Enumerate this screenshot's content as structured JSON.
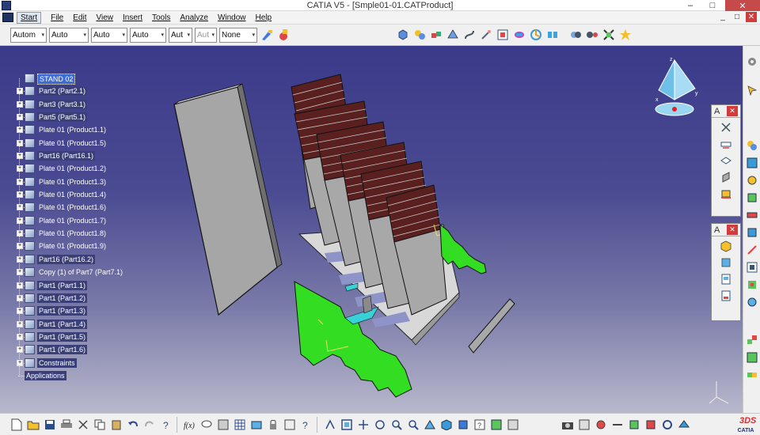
{
  "window": {
    "title": "CATIA V5 - [Smple01-01.CATProduct]",
    "min": "–",
    "max": "□",
    "close": "✕"
  },
  "menubar": {
    "items": [
      "Start",
      "File",
      "Edit",
      "View",
      "Insert",
      "Tools",
      "Analyze",
      "Window",
      "Help"
    ],
    "mdi_min": "_",
    "mdi_max": "□",
    "mdi_close": "✕"
  },
  "toolbar": {
    "dropdowns": [
      {
        "value": "Autom",
        "disabled": false
      },
      {
        "value": "Auto",
        "disabled": false
      },
      {
        "value": "Auto",
        "disabled": false
      },
      {
        "value": "Auto",
        "disabled": false
      },
      {
        "value": "Aut",
        "disabled": false
      },
      {
        "value": "Aut",
        "disabled": true
      },
      {
        "value": "None",
        "disabled": false
      }
    ],
    "arrow": "▾"
  },
  "tree": {
    "expand": "+",
    "nodes": [
      {
        "label": "STAND 02",
        "kind": "root"
      },
      {
        "label": "Part2 (Part2.1)",
        "kind": "sel"
      },
      {
        "label": "Part3 (Part3.1)",
        "kind": "sel"
      },
      {
        "label": "Part5 (Part5.1)",
        "kind": "sel"
      },
      {
        "label": "Plate 01 (Product1.1)",
        "kind": "normal"
      },
      {
        "label": "Plate 01 (Product1.5)",
        "kind": "normal"
      },
      {
        "label": "Part16 (Part16.1)",
        "kind": "sel"
      },
      {
        "label": "Plate 01 (Product1.2)",
        "kind": "normal"
      },
      {
        "label": "Plate 01 (Product1.3)",
        "kind": "normal"
      },
      {
        "label": "Plate 01 (Product1.4)",
        "kind": "normal"
      },
      {
        "label": "Plate 01 (Product1.6)",
        "kind": "normal"
      },
      {
        "label": "Plate 01 (Product1.7)",
        "kind": "normal"
      },
      {
        "label": "Plate 01 (Product1.8)",
        "kind": "normal"
      },
      {
        "label": "Plate 01 (Product1.9)",
        "kind": "normal"
      },
      {
        "label": "Part16 (Part16.2)",
        "kind": "sel"
      },
      {
        "label": "Copy (1) of Part7 (Part7.1)",
        "kind": "normal"
      },
      {
        "label": "Part1 (Part1.1)",
        "kind": "sel"
      },
      {
        "label": "Part1 (Part1.2)",
        "kind": "sel"
      },
      {
        "label": "Part1 (Part1.3)",
        "kind": "sel"
      },
      {
        "label": "Part1 (Part1.4)",
        "kind": "sel"
      },
      {
        "label": "Part1 (Part1.5)",
        "kind": "sel"
      },
      {
        "label": "Part1 (Part1.6)",
        "kind": "sel"
      },
      {
        "label": "Constraints",
        "kind": "sel"
      },
      {
        "label": "Applications",
        "kind": "sel"
      }
    ]
  },
  "palette1": {
    "label": "A",
    "close": "✕"
  },
  "palette2": {
    "label": "A",
    "close": "✕"
  },
  "compass_axes": {
    "x": "x",
    "y": "y",
    "z": "z"
  },
  "colors": {
    "viewport_top": "#3a3a8a",
    "viewport_bottom": "#b8b8cc",
    "green": "#33dd22",
    "brick": "#5a2020",
    "plate": "#a8a8a8"
  },
  "logo": {
    "text": "CATIA",
    "mark": "3DS"
  }
}
